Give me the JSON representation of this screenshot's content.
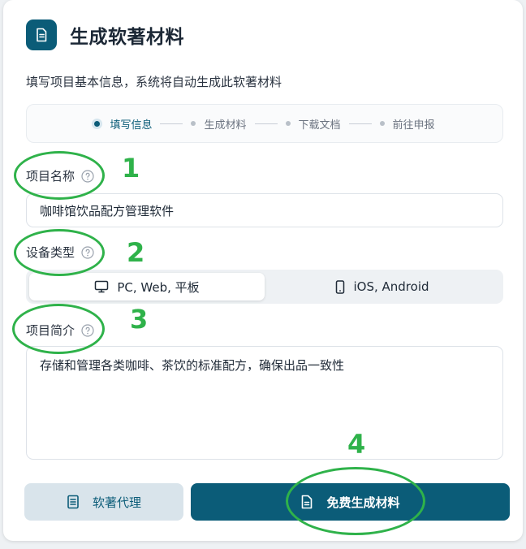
{
  "header": {
    "title": "生成软著材料",
    "icon": "document-icon"
  },
  "subtitle": "填写项目基本信息，系统将自动生成此软著材料",
  "steps": [
    {
      "label": "填写信息",
      "active": true
    },
    {
      "label": "生成材料",
      "active": false
    },
    {
      "label": "下载文档",
      "active": false
    },
    {
      "label": "前往申报",
      "active": false
    }
  ],
  "fields": {
    "project_name": {
      "label": "项目名称",
      "value": "咖啡馆饮品配方管理软件"
    },
    "device_type": {
      "label": "设备类型",
      "options": [
        {
          "label": "PC, Web, 平板",
          "icon": "monitor-icon",
          "selected": true
        },
        {
          "label": "iOS, Android",
          "icon": "phone-icon",
          "selected": false
        }
      ]
    },
    "project_intro": {
      "label": "项目简介",
      "value": "存储和管理各类咖啡、茶饮的标准配方，确保出品一致性"
    }
  },
  "buttons": {
    "agent": {
      "label": "软著代理",
      "icon": "list-document-icon"
    },
    "generate": {
      "label": "免费生成材料",
      "icon": "document-icon"
    }
  },
  "annotations": [
    "1",
    "2",
    "3",
    "4"
  ],
  "colors": {
    "primary": "#0b5c78",
    "annotation": "#2fb24a",
    "secondary_button": "#d9e4eb"
  }
}
